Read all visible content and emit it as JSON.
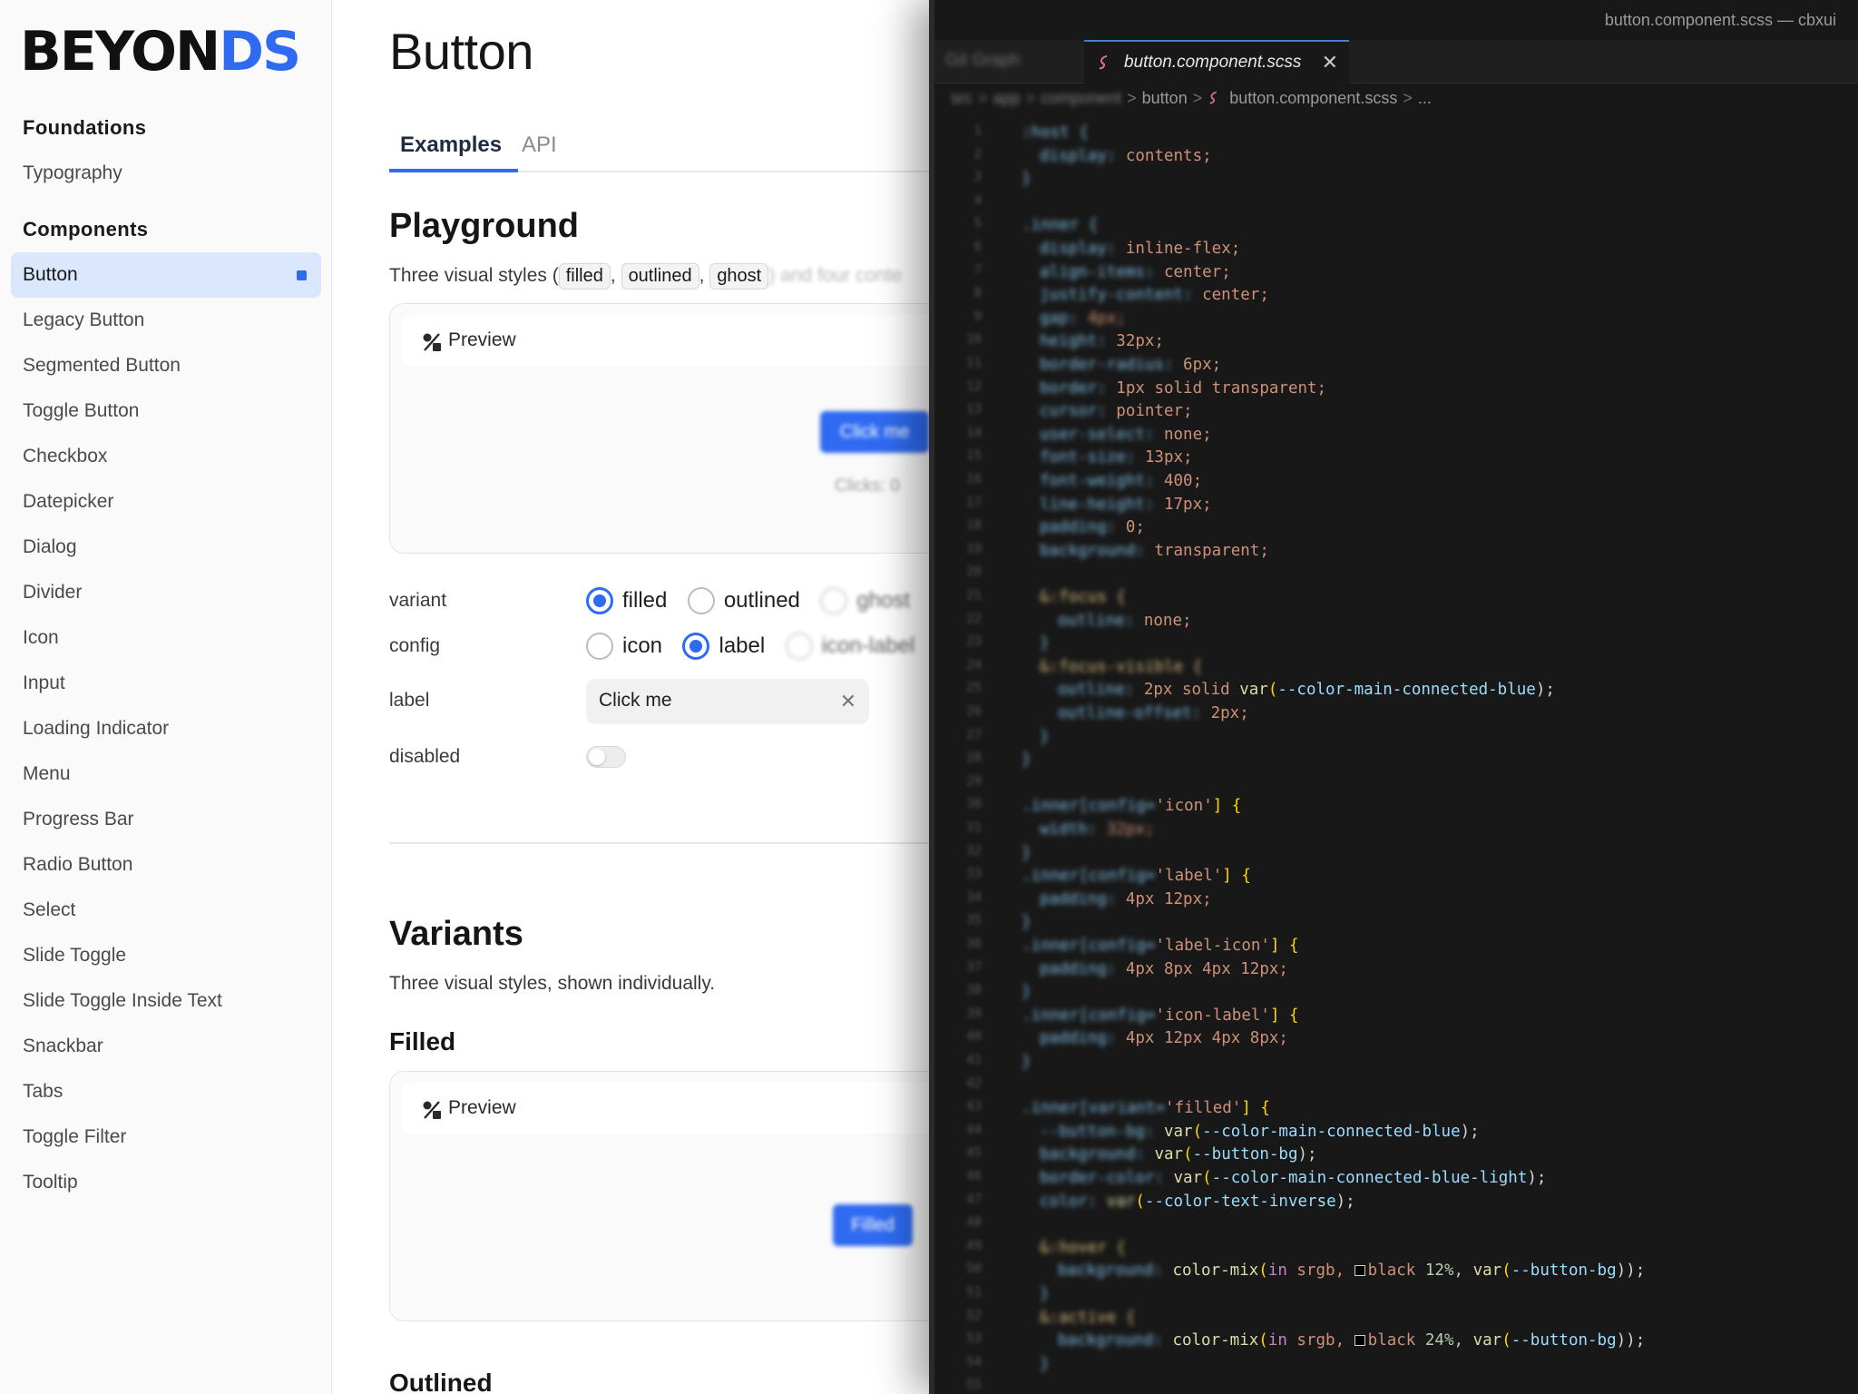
{
  "brand": {
    "part1": "BEYON",
    "part2": "DS",
    "accent": "#2f6bf2"
  },
  "sidebar": {
    "section_foundations": "Foundations",
    "foundation_items": [
      {
        "label": "Typography"
      }
    ],
    "section_components": "Components",
    "component_items": [
      {
        "label": "Button",
        "active": true
      },
      {
        "label": "Legacy Button"
      },
      {
        "label": "Segmented Button"
      },
      {
        "label": "Toggle Button"
      },
      {
        "label": "Checkbox"
      },
      {
        "label": "Datepicker"
      },
      {
        "label": "Dialog"
      },
      {
        "label": "Divider"
      },
      {
        "label": "Icon"
      },
      {
        "label": "Input"
      },
      {
        "label": "Loading Indicator"
      },
      {
        "label": "Menu"
      },
      {
        "label": "Progress Bar"
      },
      {
        "label": "Radio Button"
      },
      {
        "label": "Select"
      },
      {
        "label": "Slide Toggle"
      },
      {
        "label": "Slide Toggle Inside Text"
      },
      {
        "label": "Snackbar"
      },
      {
        "label": "Tabs"
      },
      {
        "label": "Toggle Filter"
      },
      {
        "label": "Tooltip"
      }
    ]
  },
  "main": {
    "title": "Button",
    "tabs": [
      {
        "label": "Examples",
        "active": true
      },
      {
        "label": "API"
      }
    ],
    "playground": {
      "heading": "Playground",
      "desc_prefix": "Three visual styles (",
      "chip_filled": "filled",
      "chip_outlined": "outlined",
      "chip_ghost": "ghost",
      "desc_comma": ",",
      "desc_suffix": ") and four conte",
      "preview_label": "Preview",
      "demo_button": "Click me",
      "demo_clicks": "Clicks: 0",
      "props": {
        "variant": {
          "label": "variant",
          "options": [
            "filled",
            "outlined",
            "ghost"
          ],
          "selected": "filled"
        },
        "config": {
          "label": "config",
          "options": [
            "icon",
            "label",
            "icon-label"
          ],
          "selected": "label"
        },
        "label": {
          "label": "label",
          "value": "Click me",
          "clear_glyph": "✕"
        },
        "disabled": {
          "label": "disabled",
          "value": false
        }
      }
    },
    "variants": {
      "heading": "Variants",
      "desc": "Three visual styles, shown individually.",
      "filled_heading": "Filled",
      "preview_label": "Preview",
      "demo_button": "Filled",
      "outlined_heading": "Outlined"
    }
  },
  "editor": {
    "window_title": "button.component.scss — cbxui",
    "tabs": [
      {
        "label": "Git Graph"
      },
      {
        "label": "button.component.scss",
        "active": true,
        "close": "✕"
      }
    ],
    "breadcrumb": [
      "src",
      "app",
      "component",
      "button",
      "button.component.scss",
      "..."
    ],
    "breadcrumb_sep": ">",
    "line_numbers": [
      "1",
      "2",
      "3",
      "4",
      "5",
      "6",
      "7",
      "8",
      "9",
      "10",
      "11",
      "12",
      "13",
      "14",
      "15",
      "16",
      "17",
      "18",
      "19",
      "20",
      "21",
      "22",
      "23",
      "24",
      "25",
      "26",
      "27",
      "28",
      "29",
      "30",
      "31",
      "32",
      "33",
      "34",
      "35",
      "36",
      "37",
      "38",
      "39",
      "40",
      "41",
      "42",
      "43",
      "44",
      "45",
      "46",
      "47",
      "48",
      "49",
      "50",
      "51",
      "52",
      "53",
      "54",
      "55"
    ],
    "code": {
      "l1_sel": ":host {",
      "l2_prop": "display:",
      "l2_val": " contents;",
      "l3_close": "}",
      "l5_sel": ".inner {",
      "l6_prop": "display:",
      "l6_val": " inline-flex;",
      "l7_prop": "align-items:",
      "l7_val": " center;",
      "l8_prop": "justify-content:",
      "l8_val": " center;",
      "l9_prop": "gap:",
      "l9_val": " 4px;",
      "l10_prop": "height:",
      "l10_val": " 32px;",
      "l11_prop": "border-radius:",
      "l11_val": " 6px;",
      "l12_prop": "border:",
      "l12_val": " 1px solid transparent;",
      "l13_prop": "cursor:",
      "l13_val": " pointer;",
      "l14_prop": "user-select:",
      "l14_val": " none;",
      "l15_prop": "font-size:",
      "l15_val": " 13px;",
      "l16_prop": "font-weight:",
      "l16_val": " 400;",
      "l17_prop": "line-height:",
      "l17_val": " 17px;",
      "l18_prop": "padding:",
      "l18_val": " 0;",
      "l19_prop": "background:",
      "l19_val": " transparent;",
      "l21_sel": "&:focus {",
      "l22_prop": "outline:",
      "l22_val": " none;",
      "l24_sel": "&:focus-visible {",
      "l25_prop": "outline:",
      "l25_val1": " 2px solid ",
      "l25_fn": "var",
      "l25_var": "--color-main-connected-blue",
      "l25_end": ");",
      "l26_prop": "outline-offset:",
      "l26_val": " 2px;",
      "l30_sel": ".inner[config=",
      "l30_str": "'icon'",
      "l30_end": "] {",
      "l31_prop": "width:",
      "l31_val": " 32px;",
      "l33_sel": ".inner[config=",
      "l33_str": "'label'",
      "l33_end": "] {",
      "l34_prop": "padding:",
      "l34_val": " 4px 12px;",
      "l36_sel": ".inner[config=",
      "l36_str": "'label-icon'",
      "l36_end": "] {",
      "l37_prop": "padding:",
      "l37_val": " 4px 8px 4px 12px;",
      "l39_sel": ".inner[config=",
      "l39_str": "'icon-label'",
      "l39_end": "] {",
      "l40_prop": "padding:",
      "l40_val": " 4px 12px 4px 8px;",
      "l43_sel": ".inner[variant=",
      "l43_str": "'filled'",
      "l43_end": "] {",
      "l44_prop": "--button-bg:",
      "l44_fn": " var",
      "l44_var": "--color-main-connected-blue",
      "l44_end": ");",
      "l45_prop": "background:",
      "l45_fn": " var",
      "l45_var": "--button-bg",
      "l45_end": ");",
      "l46_prop": "border-color:",
      "l46_fn": " var",
      "l46_var": "--color-main-connected-blue-light",
      "l46_end": ");",
      "l47_prop": "color:",
      "l47_fn": " var",
      "l47_var": "--color-text-inverse",
      "l47_end": ");",
      "l49_sel": "&:hover {",
      "l50_prop": "background:",
      "l50_fn": " color-mix",
      "l50_in": "in",
      "l50_srgb": " srgb,",
      "l50_black": "black",
      "l50_pct": " 12%,",
      "l50_var_fn": " var",
      "l50_var": "--button-bg",
      "l50_end": "));",
      "l52_sel": "&:active {",
      "l53_prop": "background:",
      "l53_fn": " color-mix",
      "l53_in": "in",
      "l53_srgb": " srgb,",
      "l53_black": "black",
      "l53_pct": " 24%,",
      "l53_var_fn": " var",
      "l53_var": "--button-bg",
      "l53_end": "));"
    }
  }
}
